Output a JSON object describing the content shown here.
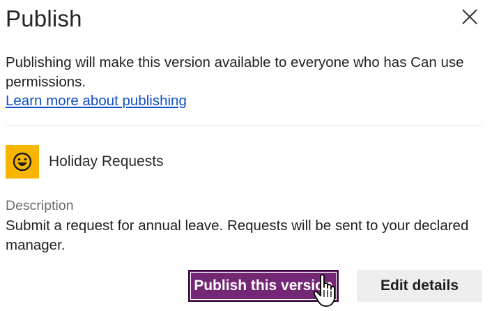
{
  "dialog": {
    "title": "Publish",
    "close_icon": "close-icon"
  },
  "intro": {
    "text": "Publishing will make this version available to everyone who has Can use permissions.",
    "link_label": "Learn more about publishing"
  },
  "app": {
    "name": "Holiday Requests",
    "icon": "smiley-icon",
    "icon_bg_color": "#f7b500"
  },
  "description": {
    "label": "Description",
    "text": "Submit a request for annual leave. Requests will be sent to your declared manager."
  },
  "buttons": {
    "publish_label": "Publish this version",
    "edit_label": "Edit details"
  },
  "colors": {
    "primary": "#742774",
    "link": "#0f4fc6",
    "secondary_bg": "#eeeeee"
  }
}
